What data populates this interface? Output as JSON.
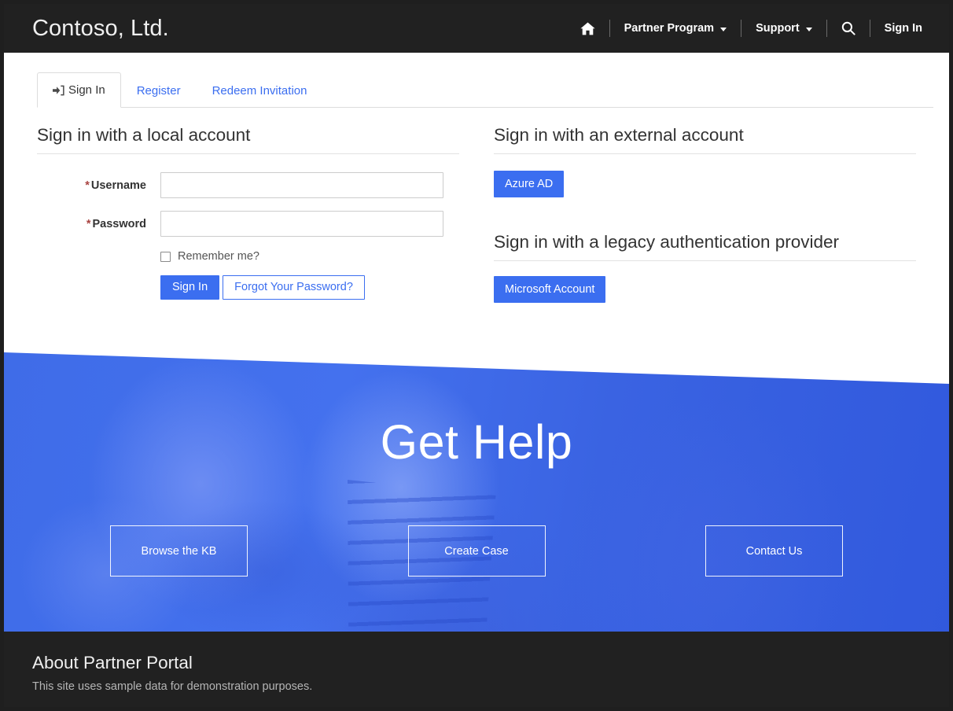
{
  "header": {
    "brand": "Contoso, Ltd.",
    "nav": [
      {
        "id": "home",
        "label": "",
        "icon": "home-icon",
        "has_caret": false
      },
      {
        "id": "partner-program",
        "label": "Partner Program",
        "icon": null,
        "has_caret": true
      },
      {
        "id": "support",
        "label": "Support",
        "icon": null,
        "has_caret": true
      },
      {
        "id": "search",
        "label": "",
        "icon": "search-icon",
        "has_caret": false
      },
      {
        "id": "sign-in",
        "label": "Sign In",
        "icon": null,
        "has_caret": false
      }
    ]
  },
  "tabs": [
    {
      "id": "sign-in",
      "label": "Sign In",
      "icon": "sign-in-icon",
      "active": true
    },
    {
      "id": "register",
      "label": "Register",
      "icon": null,
      "active": false
    },
    {
      "id": "redeem-invitation",
      "label": "Redeem Invitation",
      "icon": null,
      "active": false
    }
  ],
  "local_account": {
    "title": "Sign in with a local account",
    "username_label": "Username",
    "username_value": "",
    "username_placeholder": "",
    "password_label": "Password",
    "password_value": "",
    "password_placeholder": "",
    "required_marker": "*",
    "remember_label": "Remember me?",
    "remember_checked": false,
    "signin_button": "Sign In",
    "forgot_button": "Forgot Your Password?"
  },
  "external_account": {
    "title": "Sign in with an external account",
    "providers": [
      {
        "id": "azure-ad",
        "label": "Azure AD"
      }
    ]
  },
  "legacy_account": {
    "title": "Sign in with a legacy authentication provider",
    "providers": [
      {
        "id": "microsoft-account",
        "label": "Microsoft Account"
      }
    ]
  },
  "hero": {
    "title": "Get Help",
    "buttons": [
      {
        "id": "browse-kb",
        "label": "Browse the KB"
      },
      {
        "id": "create-case",
        "label": "Create Case"
      },
      {
        "id": "contact-us",
        "label": "Contact Us"
      }
    ]
  },
  "footer": {
    "title": "About Partner Portal",
    "text": "This site uses sample data for demonstration purposes."
  },
  "colors": {
    "header_bg": "#212121",
    "accent_blue": "#3b6ef0",
    "hero_blue": "#4471ee",
    "footer_bg": "#212121",
    "required_red": "#a94442"
  }
}
